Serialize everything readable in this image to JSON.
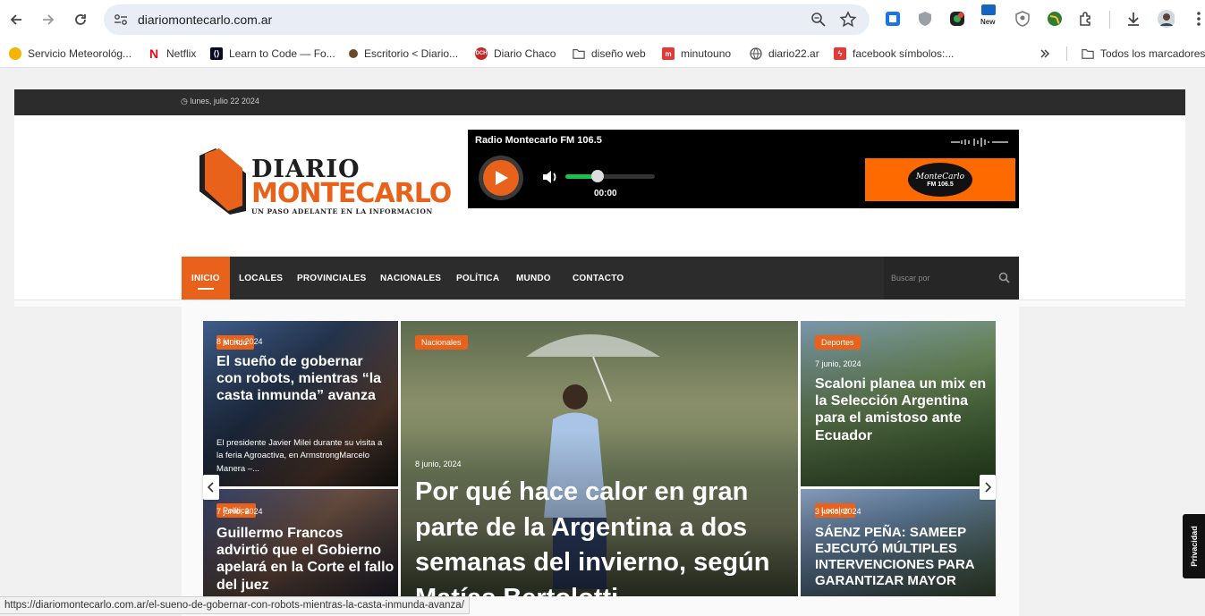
{
  "browser": {
    "url": "diariomontecarlo.com.ar",
    "bookmarks": [
      {
        "label": "Servicio Meteorológ...",
        "icon": "google-weather-icon",
        "color": "#f4b400"
      },
      {
        "label": "Netflix",
        "icon": "netflix-icon",
        "color": "#e50914"
      },
      {
        "label": "Learn to Code — Fo...",
        "icon": "freecodecamp-icon",
        "color": "#0a0a23"
      },
      {
        "label": "Escritorio < Diario...",
        "icon": "wordpress-icon",
        "color": "#6b4a2b"
      },
      {
        "label": "Diario Chaco",
        "icon": "diario-chaco-icon",
        "color": "#c62828"
      },
      {
        "label": "diseño web",
        "icon": "folder-icon",
        "color": "#555555"
      },
      {
        "label": "minutouno",
        "icon": "minutouno-icon",
        "color": "#e53935"
      },
      {
        "label": "diario22.ar",
        "icon": "globe-icon",
        "color": "#555555"
      },
      {
        "label": "facebook símbolos:...",
        "icon": "bolt-icon",
        "color": "#e53935"
      }
    ],
    "all_bookmarks": "Todos los marcadores",
    "ext_new_label": "New",
    "status_url": "https://diariomontecarlo.com.ar/el-sueno-de-gobernar-con-robots-mientras-la-casta-inmunda-avanza/"
  },
  "site": {
    "date": "lunes, julio 22 2024",
    "logo": {
      "word1": "DIARIO",
      "word2": "MONTECARLO",
      "tagline": "UN PASO ADELANTE EN LA INFORMACION"
    },
    "player": {
      "title": "Radio Montecarlo FM 106.5",
      "time": "00:00",
      "volume": 0.36,
      "badge_name": "MonteCarlo",
      "badge_freq": "FM 106.5"
    },
    "nav": [
      "INICIO",
      "LOCALES",
      "PROVINCIALES",
      "NACIONALES",
      "POLÍTICA",
      "MUNDO",
      "CONTACTO"
    ],
    "search_placeholder": "Buscar por",
    "privacy": "Privacidad"
  },
  "cards": [
    {
      "category": "Mundo",
      "date": "8 junio, 2024",
      "title": "El sueño de gobernar con robots, mientras “la casta inmunda” avanza",
      "excerpt": "El presidente Javier Milei durante su visita a la feria Agroactiva, en ArmstrongMarcelo Manera –..."
    },
    {
      "category": "Nacionales",
      "date": "8 junio, 2024",
      "title": "Por qué hace calor en gran parte de la Argentina a dos semanas del invierno, según Matías Bertolotti"
    },
    {
      "category": "Deportes",
      "date": "7 junio, 2024",
      "title": "Scaloni planea un mix en la Selección Argentina para el amistoso ante Ecuador"
    },
    {
      "category": "Política",
      "date": "7 junio, 2024",
      "title": "Guillermo Francos advirtió que el Gobierno apelará en la Corte el fallo del juez"
    },
    {
      "category": "Locales",
      "date": "3 junio, 2024",
      "title": "SÁENZ PEÑA: SAMEEP EJECUTÓ MÚLTIPLES INTERVENCIONES PARA GARANTIZAR MAYOR"
    }
  ],
  "colors": {
    "accent": "#e8621b",
    "dark": "#2c2c2c"
  }
}
